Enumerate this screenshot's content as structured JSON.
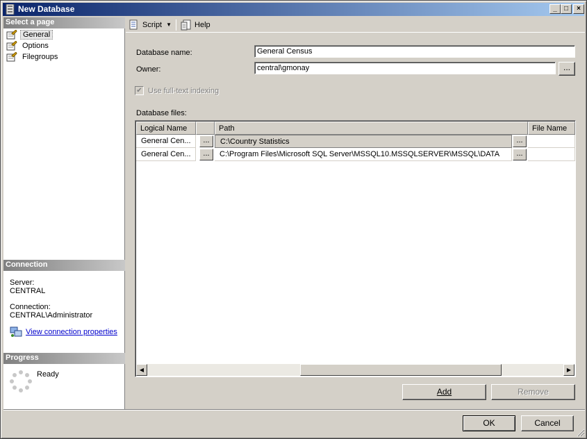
{
  "window": {
    "title": "New Database"
  },
  "left": {
    "select_page_header": "Select a page",
    "pages": [
      {
        "label": "General",
        "icon": "page-icon"
      },
      {
        "label": "Options",
        "icon": "page-icon"
      },
      {
        "label": "Filegroups",
        "icon": "page-icon"
      }
    ],
    "connection_header": "Connection",
    "server_label": "Server:",
    "server_value": "CENTRAL",
    "connection_label": "Connection:",
    "connection_value": "CENTRAL\\Administrator",
    "view_props_link": "View connection properties",
    "progress_header": "Progress",
    "progress_status": "Ready"
  },
  "toolbar": {
    "script_label": "Script",
    "help_label": "Help"
  },
  "form": {
    "db_name_label": "Database name:",
    "db_name_value": "General Census",
    "owner_label": "Owner:",
    "owner_value": "central\\gmonay",
    "owner_browse": "...",
    "fulltext_label": "Use full-text indexing",
    "db_files_label": "Database files:"
  },
  "grid": {
    "columns": [
      "Logical Name",
      "",
      "Path",
      "",
      "File Name"
    ],
    "rows": [
      {
        "logical_name": "General Cen...",
        "browse": "...",
        "path": "C:\\Country Statistics",
        "path_browse": "...",
        "file_name": ""
      },
      {
        "logical_name": "General Cen...",
        "browse": "...",
        "path": "C:\\Program Files\\Microsoft SQL Server\\MSSQL10.MSSQLSERVER\\MSSQL\\DATA",
        "path_browse": "...",
        "file_name": ""
      }
    ]
  },
  "buttons": {
    "add": "Add",
    "remove": "Remove",
    "ok": "OK",
    "cancel": "Cancel"
  }
}
